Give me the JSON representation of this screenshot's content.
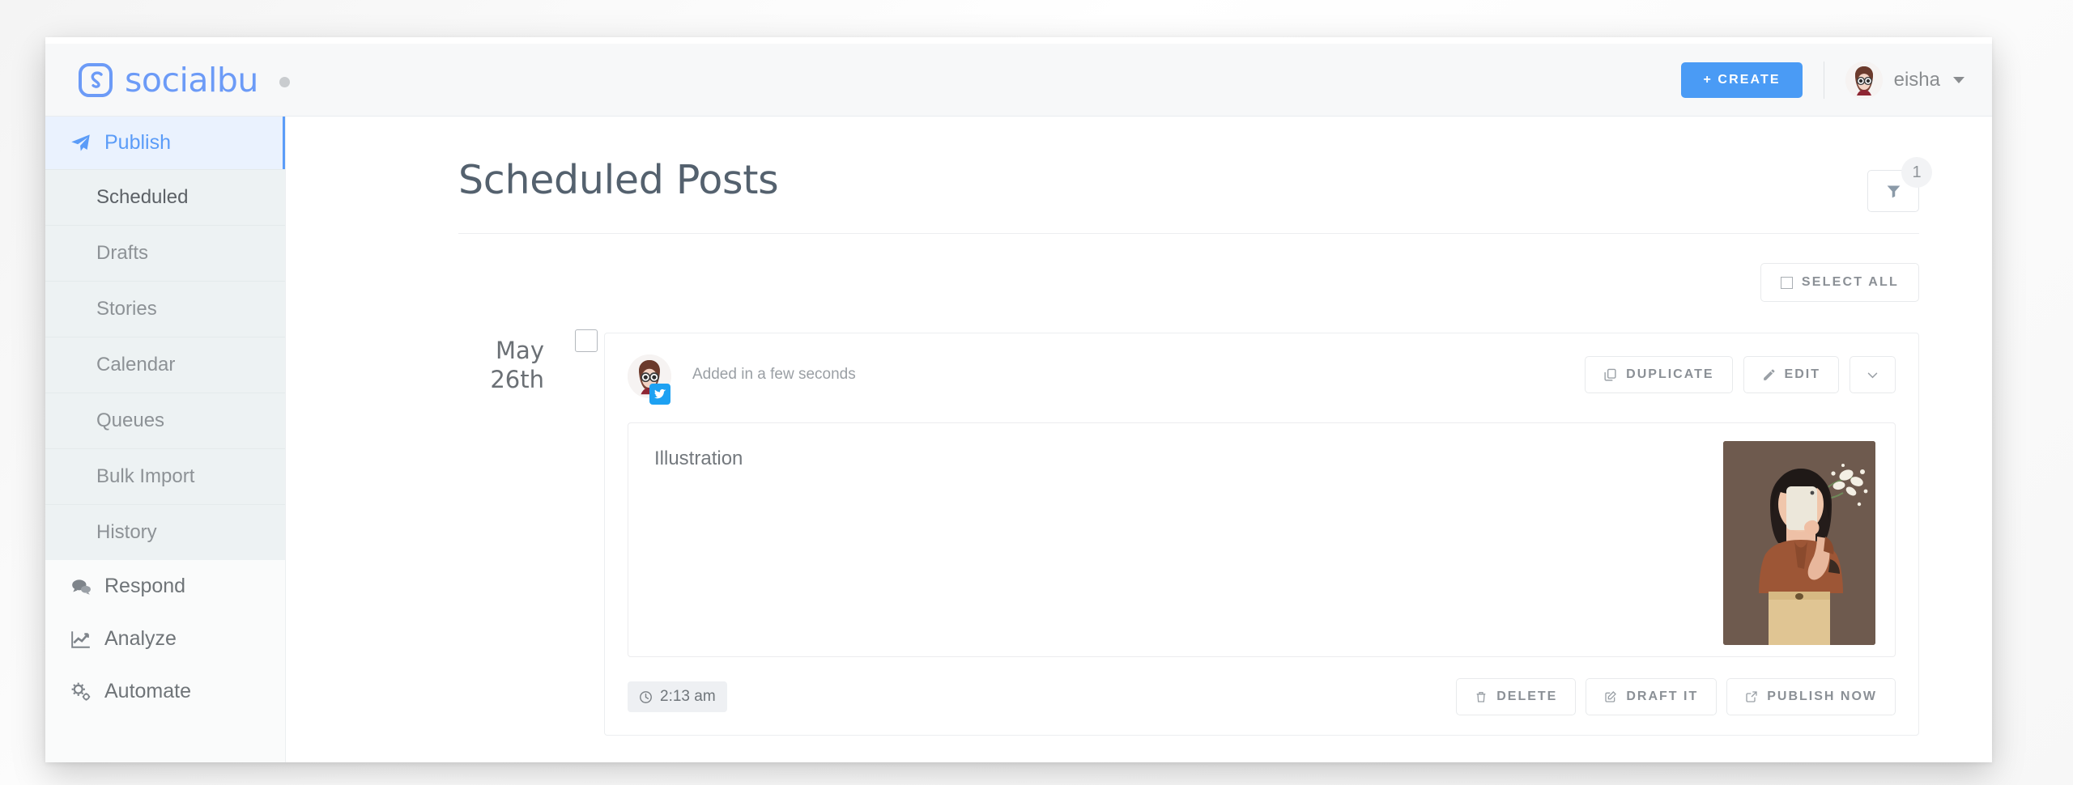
{
  "brand": {
    "name": "socialbu",
    "logo_icon": "socialbu-s-icon",
    "status_dot": "idle-dot"
  },
  "header": {
    "create_label": "+ CREATE",
    "user_name": "eisha",
    "avatar_icon": "user-avatar",
    "caret_icon": "chevron-down-icon",
    "accent_color": "#4a9bf5"
  },
  "sidebar": {
    "primary": [
      {
        "label": "Publish",
        "icon": "paper-plane-icon",
        "active": true
      },
      {
        "label": "Respond",
        "icon": "chat-bubbles-icon",
        "active": false
      },
      {
        "label": "Analyze",
        "icon": "chart-line-icon",
        "active": false
      },
      {
        "label": "Automate",
        "icon": "gears-icon",
        "active": false
      }
    ],
    "sub_items": [
      {
        "label": "Scheduled",
        "active": true
      },
      {
        "label": "Drafts",
        "active": false
      },
      {
        "label": "Stories",
        "active": false
      },
      {
        "label": "Calendar",
        "active": false
      },
      {
        "label": "Queues",
        "active": false
      },
      {
        "label": "Bulk Import",
        "active": false
      },
      {
        "label": "History",
        "active": false
      }
    ]
  },
  "main": {
    "page_title": "Scheduled Posts",
    "filter": {
      "icon": "funnel-icon",
      "badge": "1"
    },
    "select_all_label": "SELECT ALL",
    "group": {
      "date_line1": "May",
      "date_line2": "26th",
      "checkbox_checked": false
    },
    "post": {
      "account_avatar_icon": "account-avatar",
      "network_icon": "twitter-icon",
      "added_text": "Added in a few seconds",
      "duplicate_label": "DUPLICATE",
      "duplicate_icon": "copy-icon",
      "edit_label": "EDIT",
      "edit_icon": "pencil-icon",
      "more_icon": "chevron-down-icon",
      "content_text": "Illustration",
      "attachment_icon": "image-thumbnail",
      "time_label": "2:13 am",
      "time_icon": "clock-icon",
      "delete_label": "DELETE",
      "delete_icon": "trash-icon",
      "draft_label": "DRAFT IT",
      "draft_icon": "edit-square-icon",
      "publish_label": "PUBLISH NOW",
      "publish_icon": "external-link-icon"
    }
  }
}
